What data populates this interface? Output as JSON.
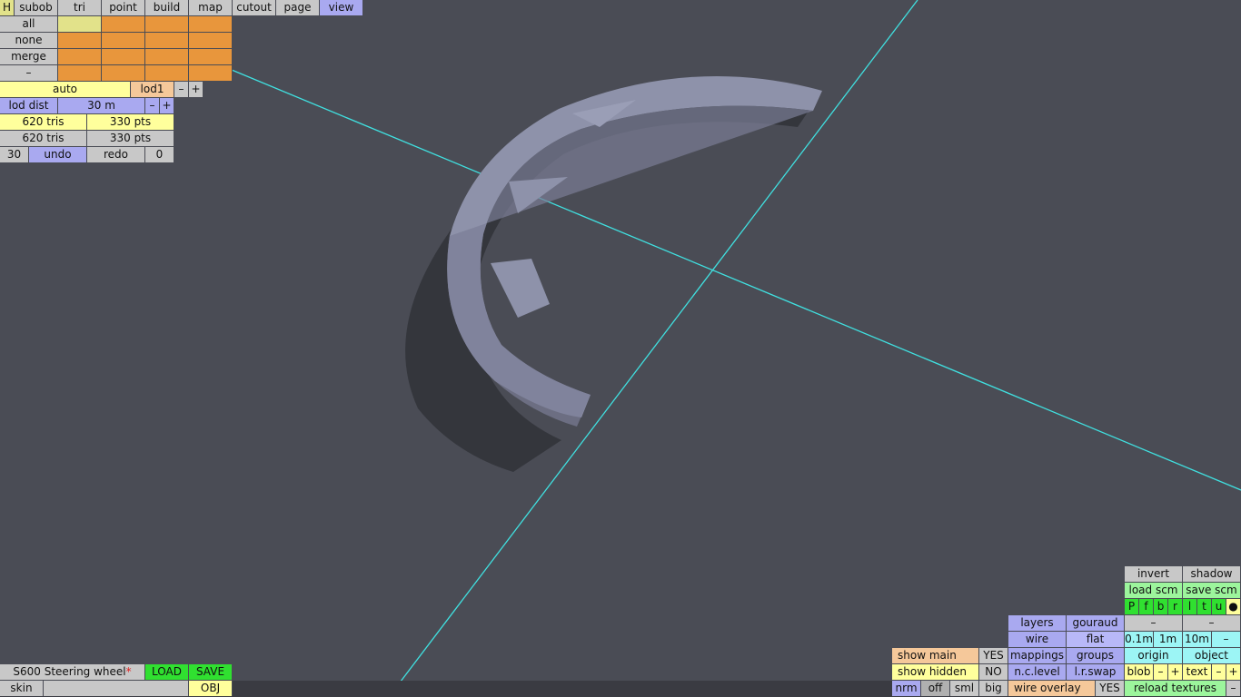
{
  "top_tabs": {
    "h": "H",
    "subob": "subob",
    "tri": "tri",
    "point": "point",
    "build": "build",
    "map": "map",
    "cutout": "cutout",
    "page": "page",
    "view": "view"
  },
  "selection": {
    "all": "all",
    "none": "none",
    "merge": "merge",
    "dash": "–"
  },
  "lod": {
    "auto": "auto",
    "lod1": "lod1",
    "minus": "–",
    "plus": "+",
    "dist_label": "lod dist",
    "dist_value": "30 m"
  },
  "stats": {
    "tris_a": "620 tris",
    "pts_a": "330 pts",
    "tris_b": "620 tris",
    "pts_b": "330 pts"
  },
  "history": {
    "count": "30",
    "undo": "undo",
    "redo": "redo",
    "redo_count": "0"
  },
  "file": {
    "name": "S600 Steering wheel",
    "modified_mark": "*",
    "load": "LOAD",
    "save": "SAVE",
    "skin": "skin",
    "obj": "OBJ"
  },
  "view_panel": {
    "invert": "invert",
    "shadow": "shadow",
    "load_scm": "load scm",
    "save_scm": "save scm",
    "views": [
      "P",
      "f",
      "b",
      "r",
      "l",
      "t",
      "u",
      "●"
    ],
    "layers": "layers",
    "gouraud": "gouraud",
    "wire": "wire",
    "flat": "flat",
    "dash1": "–",
    "dash2": "–",
    "grid": [
      "0.1m",
      "1m",
      "10m",
      "–"
    ],
    "show_main": "show main",
    "show_main_val": "YES",
    "mappings": "mappings",
    "groups": "groups",
    "origin": "origin",
    "object": "object",
    "show_hidden": "show hidden",
    "show_hidden_val": "NO",
    "nc_level": "n.c.level",
    "lr_swap": "l.r.swap",
    "blob": "blob",
    "text": "text",
    "minus": "–",
    "plus": "+",
    "nrm": "nrm",
    "off": "off",
    "sml": "sml",
    "big": "big",
    "wire_overlay": "wire overlay",
    "wire_overlay_val": "YES",
    "reload_textures": "reload textures",
    "reload_minus": "–"
  },
  "colors": {
    "background": "#4a4c55",
    "axis": "#40e0e0",
    "model": "#8e92aa",
    "shadow": "#34363c"
  }
}
